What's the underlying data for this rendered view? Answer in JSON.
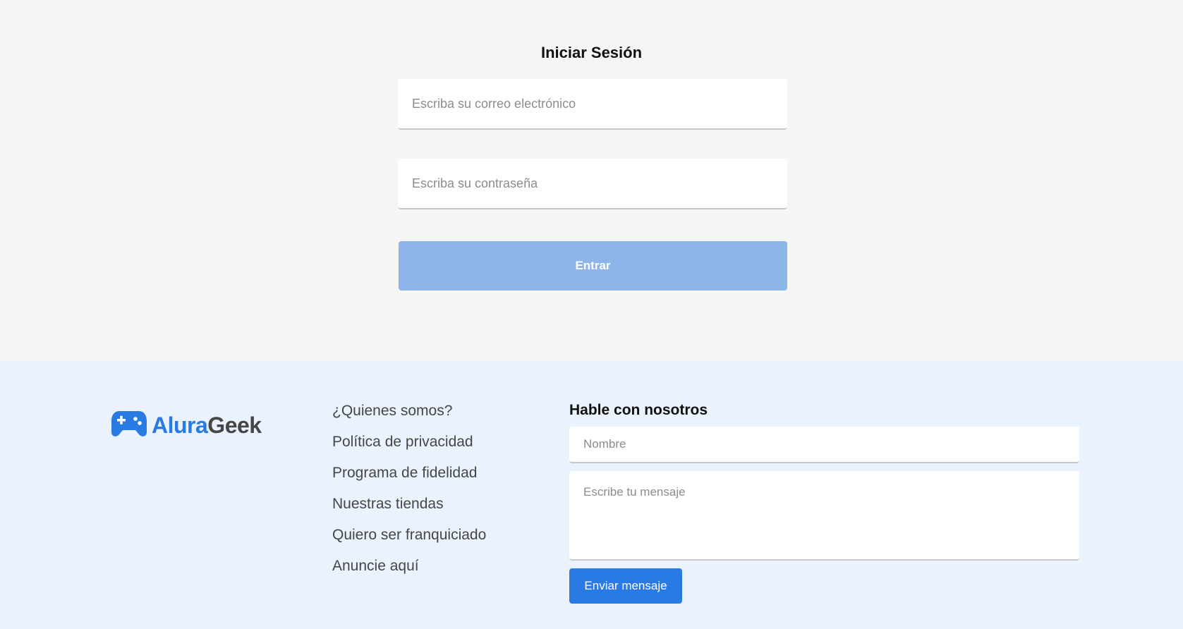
{
  "login": {
    "title": "Iniciar Sesión",
    "email_placeholder": "Escriba su correo electrónico",
    "password_placeholder": "Escriba su contraseña",
    "submit_label": "Entrar"
  },
  "footer": {
    "logo": {
      "part1": "Alura",
      "part2": "Geek",
      "icon": "gamepad-icon"
    },
    "links": [
      "¿Quienes somos?",
      "Política de privacidad",
      "Programa de fidelidad",
      "Nuestras tiendas",
      "Quiero ser franquiciado",
      "Anuncie aquí"
    ],
    "contact": {
      "title": "Hable con nosotros",
      "name_placeholder": "Nombre",
      "message_placeholder": "Escribe tu mensaje",
      "send_label": "Enviar mensaje"
    }
  },
  "colors": {
    "brand_blue": "#2a7ae4",
    "login_button": "#8eb5ea",
    "footer_bg": "#eaf2fd",
    "page_bg": "#f5f5f5"
  }
}
